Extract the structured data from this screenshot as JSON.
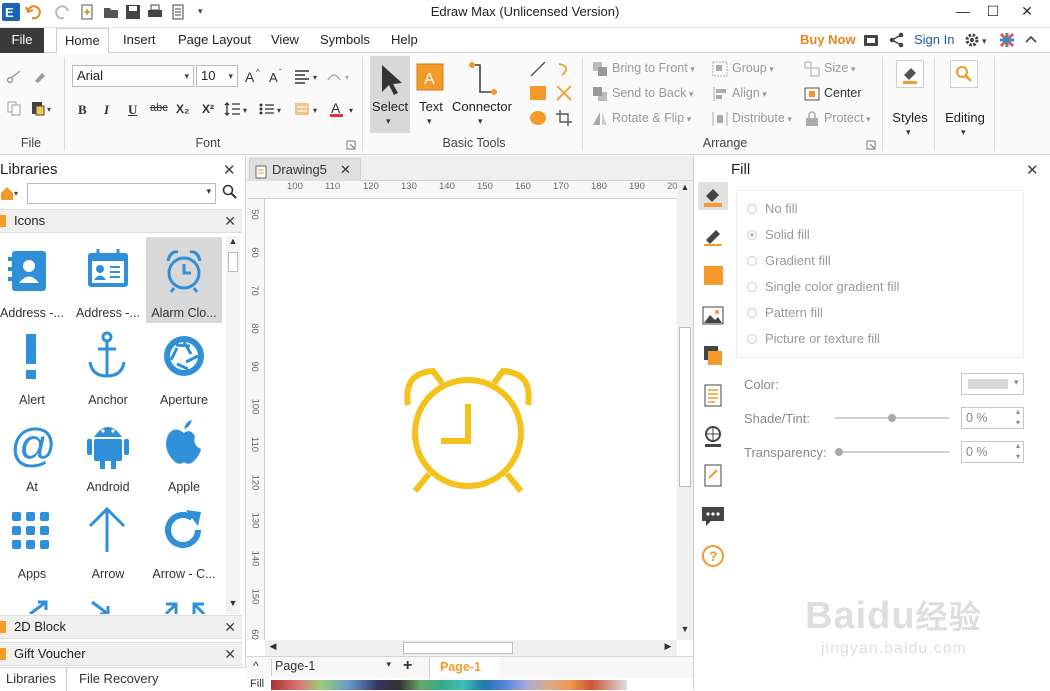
{
  "window": {
    "title": "Edraw Max (Unlicensed Version)"
  },
  "menu": {
    "file": "File",
    "items": [
      "Home",
      "Insert",
      "Page Layout",
      "View",
      "Symbols",
      "Help"
    ],
    "buy_now": "Buy Now",
    "sign_in": "Sign In"
  },
  "ribbon": {
    "groups": {
      "file": "File",
      "font": "Font",
      "basic_tools": "Basic Tools",
      "arrange": "Arrange"
    },
    "font_name": "Arial",
    "font_size": "10",
    "tools": {
      "select": "Select",
      "text": "Text",
      "connector": "Connector"
    },
    "arrange": {
      "bring_to_front": "Bring to Front",
      "send_to_back": "Send to Back",
      "rotate_flip": "Rotate & Flip",
      "group": "Group",
      "align": "Align",
      "distribute": "Distribute",
      "size": "Size",
      "center": "Center",
      "protect": "Protect"
    },
    "styles": "Styles",
    "editing": "Editing"
  },
  "libraries": {
    "title": "Libraries",
    "section": "Icons",
    "icons": [
      {
        "label": "Address -...",
        "icon": "address-book-icon"
      },
      {
        "label": "Address -...",
        "icon": "address-card-icon"
      },
      {
        "label": "Alarm Clo...",
        "icon": "alarm-clock-icon"
      },
      {
        "label": "Alert",
        "icon": "alert-icon"
      },
      {
        "label": "Anchor",
        "icon": "anchor-icon"
      },
      {
        "label": "Aperture",
        "icon": "aperture-icon"
      },
      {
        "label": "At",
        "icon": "at-icon"
      },
      {
        "label": "Android",
        "icon": "android-icon"
      },
      {
        "label": "Apple",
        "icon": "apple-icon"
      },
      {
        "label": "Apps",
        "icon": "apps-icon"
      },
      {
        "label": "Arrow",
        "icon": "arrow-up-icon"
      },
      {
        "label": "Arrow - C...",
        "icon": "arrow-circle-icon"
      }
    ],
    "other_sections": [
      "2D Block",
      "Gift Voucher"
    ],
    "bottom_tabs": [
      "Libraries",
      "File Recovery"
    ]
  },
  "document": {
    "tab": "Drawing5",
    "ruler_h": [
      "100",
      "110",
      "120",
      "130",
      "140",
      "150",
      "160",
      "170",
      "180",
      "190",
      "20"
    ],
    "ruler_v": [
      "50",
      "60",
      "70",
      "80",
      "90",
      "100",
      "110",
      "120",
      "130",
      "140",
      "150",
      "60"
    ],
    "page_select": "Page-1",
    "page_tab": "Page-1",
    "fill_label": "Fill"
  },
  "fill_panel": {
    "title": "Fill",
    "options": [
      "No fill",
      "Solid fill",
      "Gradient fill",
      "Single color gradient fill",
      "Pattern fill",
      "Picture or texture fill"
    ],
    "selected": "Solid fill",
    "color_label": "Color:",
    "shade_label": "Shade/Tint:",
    "shade_value": "0 %",
    "transparency_label": "Transparency:",
    "transparency_value": "0 %"
  },
  "colors": {
    "accent": "#f5c21b",
    "icon_blue": "#2f8fd8",
    "orange": "#f39a2b",
    "buy": "#e8861b"
  },
  "watermark": {
    "text1": "Baidu",
    "text2": "经验",
    "url": "jingyan.baidu.com"
  }
}
